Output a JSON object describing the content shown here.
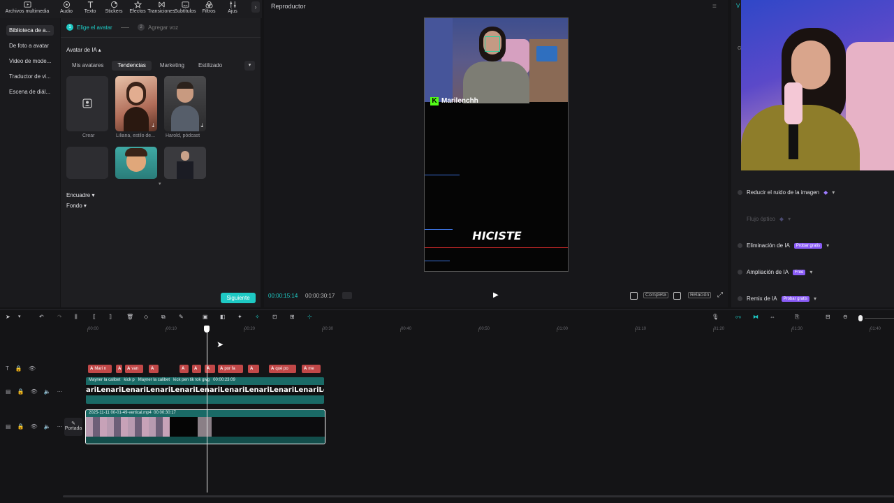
{
  "toolbar": {
    "items": [
      {
        "label": "Archivos multimedia",
        "icon": "media-icon"
      },
      {
        "label": "Audio",
        "icon": "audio-icon"
      },
      {
        "label": "Texto",
        "icon": "text-icon"
      },
      {
        "label": "Stickers",
        "icon": "sticker-icon"
      },
      {
        "label": "Efectos",
        "icon": "effects-icon"
      },
      {
        "label": "Transiciones",
        "icon": "transition-icon"
      },
      {
        "label": "Subtítulos",
        "icon": "subtitles-icon"
      },
      {
        "label": "Filtros",
        "icon": "filter-icon"
      },
      {
        "label": "Ajus",
        "icon": "adjust-icon"
      }
    ]
  },
  "leftnav": {
    "items": [
      {
        "label": "Biblioteca de a..."
      },
      {
        "label": "De foto a avatar"
      },
      {
        "label": "Video de mode..."
      },
      {
        "label": "Traductor de vi..."
      },
      {
        "label": "Escena de diál..."
      }
    ]
  },
  "library": {
    "step1_num": "1",
    "step1_label": "Elige el avatar",
    "step2_num": "2",
    "step2_label": "Agregar voz",
    "section_title": "Avatar de IA",
    "tabs": [
      "Mis avatares",
      "Tendencias",
      "Marketing",
      "Estilizado"
    ],
    "create_label": "Crear",
    "card1_label": "Liliana, estilo de...",
    "card2_label": "Harold, pódcast",
    "encuadre": "Encuadre",
    "fondo": "Fondo",
    "next_button": "Siguiente"
  },
  "player": {
    "title": "Reproductor",
    "current_time": "00:00:15:14",
    "total_time": "00:00:30:17",
    "full_label": "Completa",
    "ratio_label": "Relación",
    "overlay_name": "Marilenchh",
    "overlay_word": "HICISTE"
  },
  "rightpanel": {
    "options": [
      {
        "label": "Reducir el ruido de la imagen",
        "badge": ""
      },
      {
        "label": "Flujo óptico",
        "badge": ""
      },
      {
        "label": "Eliminación de IA",
        "badge": "Probar gratis"
      },
      {
        "label": "Ampliación de IA",
        "badge": "Free"
      },
      {
        "label": "Remix de IA",
        "badge": "Probar gratis"
      }
    ]
  },
  "timeline": {
    "ticks": [
      "00:00",
      "00:10",
      "00:20",
      "00:30",
      "00:40",
      "00:50",
      "01:00",
      "01:10",
      "01:20",
      "01:30",
      "01:40"
    ],
    "text_clips": [
      "Mari n",
      "",
      "van",
      "",
      "",
      "",
      "",
      "por fa",
      "",
      "qué po",
      "me"
    ],
    "caption_clip_labels": [
      "Mayner la calibet",
      "kick p",
      "Mayner la calibet",
      "kick pen tik tok gwg",
      "00:00:23:09"
    ],
    "caption_strip_text": "ariLenariLenariLenariLenariLenariLenariLenariLenariLenariLenariLenar",
    "video_clip_label": "2025-11-11 00-01-49-vertical.mp4",
    "video_clip_duration": "00:00:30:17",
    "cover_label": "Portada"
  },
  "colors": {
    "accent": "#1ec9c4",
    "purple": "#8a5cf6",
    "text_clip": "#c14848",
    "caption_track": "#1a6a66"
  }
}
